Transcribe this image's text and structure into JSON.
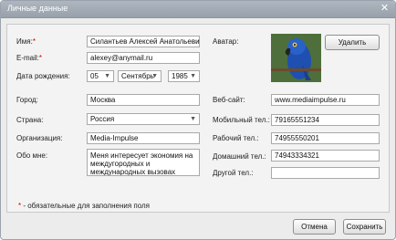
{
  "dialog": {
    "title": "Личные данные",
    "close_symbol": "✕"
  },
  "form": {
    "name_label": "Имя:",
    "name_value": "Силантьев Алексей Анатольевич",
    "email_label": "E-mail:",
    "email_value": "alexey@anymail.ru",
    "birth_label": "Дата рождения:",
    "birth_day": "05",
    "birth_month": "Сентябрь",
    "birth_year": "1985",
    "avatar_label": "Аватар:",
    "delete_button": "Удалить",
    "city_label": "Город:",
    "city_value": "Москва",
    "country_label": "Страна:",
    "country_value": "Россия",
    "org_label": "Организация:",
    "org_value": "Media-Impulse",
    "about_label": "Обо мне:",
    "about_value": "Меня интересует экономия на междугородных и международных вызовах",
    "website_label": "Веб-сайт:",
    "website_value": "www.mediaimpulse.ru",
    "mobile_label": "Мобильный тел.:",
    "mobile_value": "79165551234",
    "work_label": "Рабочий тел.:",
    "work_value": "74955550201",
    "home_label": "Домашний тел.:",
    "home_value": "74943334321",
    "other_label": "Другой тел.:",
    "other_value": "",
    "required_mark": "*",
    "footnote_text": " - обязательные для заполнения поля"
  },
  "buttons": {
    "cancel": "Отмена",
    "save": "Сохранить"
  },
  "icons": {
    "dropdown": "chevron-down-icon",
    "avatar": "parrot-avatar"
  }
}
